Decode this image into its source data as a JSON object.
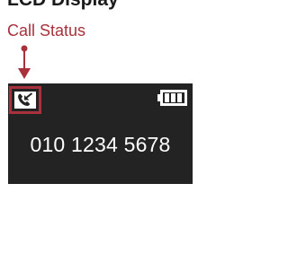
{
  "heading": "LCD Display",
  "callout": {
    "label": "Call Status",
    "color": "#a8313b"
  },
  "lcd": {
    "background": "#232323",
    "status_icon": "phone-call-arrow-icon",
    "battery_icon": "battery-full-icon",
    "number": "010 1234 5678"
  }
}
